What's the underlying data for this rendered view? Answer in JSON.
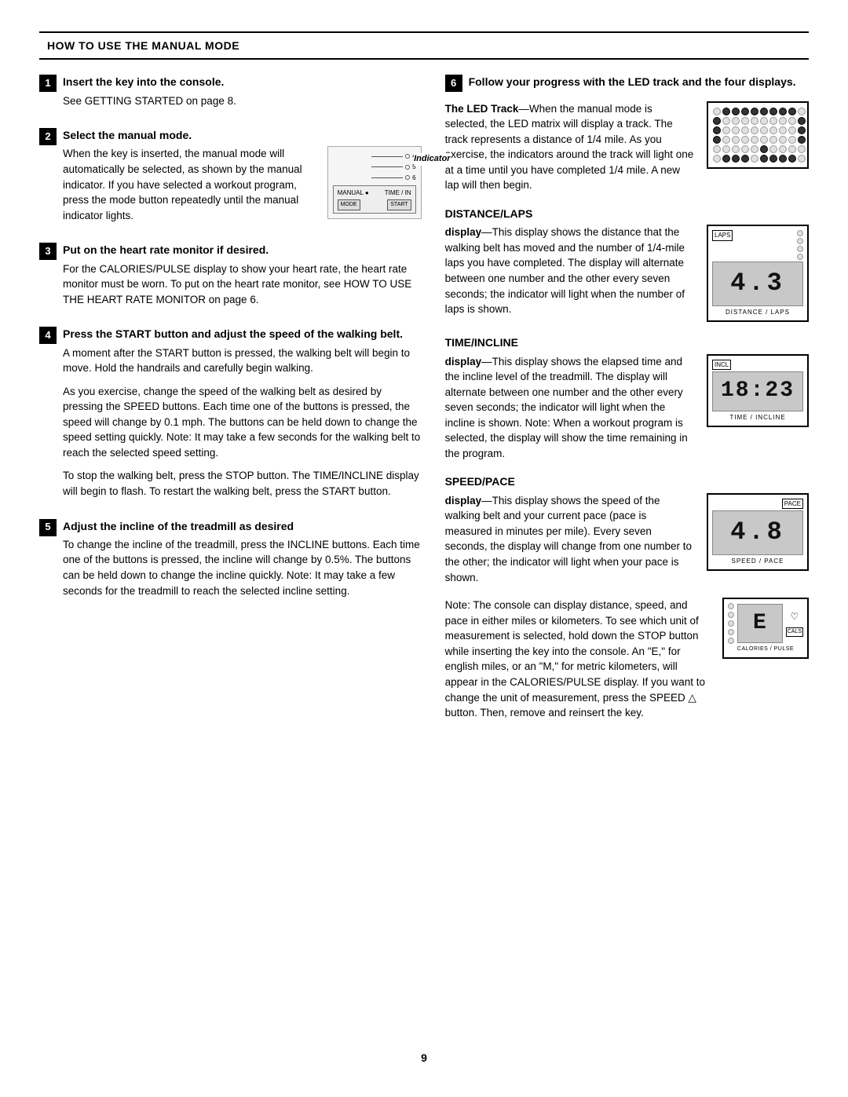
{
  "page": {
    "number": "9"
  },
  "header": {
    "title": "HOW TO USE THE MANUAL MODE"
  },
  "left_col": {
    "step1": {
      "number": "1",
      "title": "Insert the key into the console.",
      "body": "See GETTING STARTED on page 8."
    },
    "step2": {
      "number": "2",
      "title": "Select the manual mode.",
      "body": "When the key is inserted, the manual mode will automatically be selected, as shown by the manual indicator. If you have selected a workout program, press the mode button repeatedly until the manual indicator lights.",
      "indicator_label": "Indicator"
    },
    "step3": {
      "number": "3",
      "title": "Put on the heart rate monitor if desired.",
      "body": "For the CALORIES/PULSE display to show your heart rate, the heart rate monitor must be worn. To put on the heart rate monitor, see HOW TO USE THE HEART RATE MONITOR on page 6."
    },
    "step4": {
      "number": "4",
      "title": "Press the START button and adjust the speed of the walking belt.",
      "para1": "A moment after the START button is pressed, the walking belt will begin to move. Hold the handrails and carefully begin walking.",
      "para2": "As you exercise, change the speed of the walking belt as desired by pressing the SPEED buttons. Each time one of the buttons is pressed, the speed will change by 0.1 mph. The buttons can be held down to change the speed setting quickly. Note: It may take a few seconds for the walking belt to reach the selected speed setting.",
      "para3": "To stop the walking belt, press the STOP button. The TIME/INCLINE display will begin to flash. To restart the walking belt, press the START button."
    },
    "step5": {
      "number": "5",
      "title": "Adjust the incline of the treadmill as desired",
      "body": "To change the incline of the treadmill, press the INCLINE buttons. Each time one of the buttons is pressed, the incline will change by 0.5%. The buttons can be held down to change the incline quickly. Note: It may take a few seconds for the treadmill to reach the selected incline setting."
    }
  },
  "right_col": {
    "step6": {
      "number": "6",
      "title": "Follow your progress with the LED track and the four displays."
    },
    "led_track": {
      "subtitle": "The LED Track",
      "dash": "—",
      "body": "When the manual mode is selected, the LED matrix will display a track. The track represents a distance of 1/4 mile. As you exercise, the indicators around the track will light one at a time until you have completed 1/4 mile. A new lap will then begin."
    },
    "distance_laps": {
      "title": "DISTANCE/LAPS",
      "display_bold": "display",
      "dash": "—",
      "body": "This display shows the distance that the walking belt has moved and the number of 1/4-mile laps you have completed. The display will alternate between one number and the other every seven seconds; the indicator will light when the number of laps is shown.",
      "value": "4.3",
      "bottom_label": "DISTANCE / LAPS",
      "laps_label": "LAPS"
    },
    "time_incline": {
      "title": "TIME/INCLINE",
      "display_bold": "display",
      "dash": "—",
      "body": "This display shows the elapsed time and the incline level of the treadmill. The display will alternate between one number and the other every seven seconds; the indicator will light when the incline is shown. Note: When a workout program is selected, the display will show the time remaining in the program.",
      "value": "18:23",
      "bottom_label": "TIME / INCLINE",
      "incl_label": "INCL"
    },
    "speed_pace": {
      "title": "SPEED/PACE",
      "display_bold": "display",
      "dash": "—",
      "body": "This display shows the speed of the walking belt and your current pace (pace is measured in minutes per mile). Every seven seconds, the display will change from one number to the other; the indicator will light when your pace is shown.",
      "value": "4.8",
      "bottom_label": "SPEED / PACE",
      "pace_label": "PACE"
    },
    "calories_pulse": {
      "note_intro": "Note: The console can display distance, speed, and pace in either miles or kilometers. To see which unit of measurement is selected, hold down the STOP button while inserting the key into the console. An \"E,\" for english miles, or an \"M,\" for metric kilometers, will appear in the CALORIES/PULSE display. If you want to change the unit of measurement, press the SPEED",
      "triangle": "△",
      "note_end": "button. Then, remove and reinsert the key.",
      "value": "E",
      "bottom_label": "CALORIES / PULSE",
      "cals_label": "CALS"
    }
  }
}
